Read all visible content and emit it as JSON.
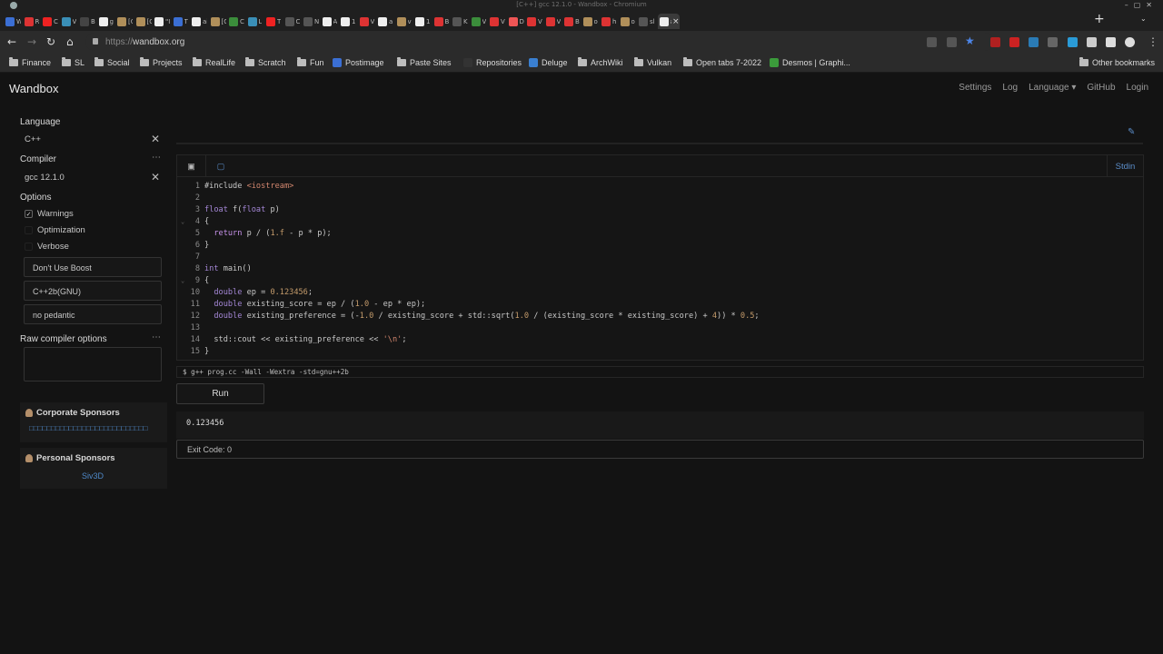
{
  "browser": {
    "window_title": "[C++] gcc 12.1.0 - Wandbox - Chromium",
    "url_scheme": "https://",
    "url_host": "wandbox.org",
    "tabs": [
      {
        "label": "W",
        "color": "#3b6fd4"
      },
      {
        "label": "R",
        "color": "#d33"
      },
      {
        "label": "C",
        "color": "#e22"
      },
      {
        "label": "V",
        "color": "#3a8fb7"
      },
      {
        "label": "B",
        "color": "#444"
      },
      {
        "label": "g",
        "color": "#eee"
      },
      {
        "label": "[C",
        "color": "#b08f5a"
      },
      {
        "label": "[C",
        "color": "#b08f5a"
      },
      {
        "label": "\"I",
        "color": "#eee"
      },
      {
        "label": "T",
        "color": "#3b6fd4"
      },
      {
        "label": "ai",
        "color": "#eee"
      },
      {
        "label": "[C",
        "color": "#b08f5a"
      },
      {
        "label": "C",
        "color": "#3b8d3b"
      },
      {
        "label": "L",
        "color": "#3a8fb7"
      },
      {
        "label": "T",
        "color": "#e22"
      },
      {
        "label": "C",
        "color": "#555"
      },
      {
        "label": "N",
        "color": "#555"
      },
      {
        "label": "A",
        "color": "#eee"
      },
      {
        "label": "1",
        "color": "#eee"
      },
      {
        "label": "V",
        "color": "#d33"
      },
      {
        "label": "a",
        "color": "#eee"
      },
      {
        "label": "v",
        "color": "#b08f5a"
      },
      {
        "label": "1",
        "color": "#eee"
      },
      {
        "label": "B",
        "color": "#d33"
      },
      {
        "label": "K",
        "color": "#555"
      },
      {
        "label": "V",
        "color": "#3b8d3b"
      },
      {
        "label": "V",
        "color": "#d33"
      },
      {
        "label": "D",
        "color": "#e55"
      },
      {
        "label": "V",
        "color": "#d33"
      },
      {
        "label": "V",
        "color": "#d33"
      },
      {
        "label": "B",
        "color": "#d33"
      },
      {
        "label": "o",
        "color": "#b08f5a"
      },
      {
        "label": "h",
        "color": "#d33"
      },
      {
        "label": "o",
        "color": "#b08f5a"
      },
      {
        "label": "sl",
        "color": "#555"
      },
      {
        "label": "a",
        "color": "#eee"
      }
    ],
    "bookmarks": [
      {
        "label": "Finance",
        "type": "folder"
      },
      {
        "label": "SL",
        "type": "folder"
      },
      {
        "label": "Social",
        "type": "folder"
      },
      {
        "label": "Projects",
        "type": "folder"
      },
      {
        "label": "RealLife",
        "type": "folder"
      },
      {
        "label": "Scratch",
        "type": "folder"
      },
      {
        "label": "Fun",
        "type": "folder"
      },
      {
        "label": "Postimage",
        "type": "site",
        "color": "#3b6fd4"
      },
      {
        "label": "Paste Sites",
        "type": "folder"
      },
      {
        "label": "Repositories",
        "type": "site",
        "color": "#333"
      },
      {
        "label": "Deluge",
        "type": "site",
        "color": "#3a7fd0"
      },
      {
        "label": "ArchWiki",
        "type": "folder"
      },
      {
        "label": "Vulkan",
        "type": "folder"
      },
      {
        "label": "Open tabs 7-2022",
        "type": "folder"
      },
      {
        "label": "Desmos | Graphi...",
        "type": "site",
        "color": "#3b9b3b"
      }
    ],
    "other_bookmarks": "Other bookmarks"
  },
  "app": {
    "brand": "Wandbox",
    "nav": [
      "Settings",
      "Log",
      "Language ▾",
      "GitHub",
      "Login"
    ]
  },
  "sidebar": {
    "language_label": "Language",
    "language_value": "C++",
    "compiler_label": "Compiler",
    "compiler_value": "gcc 12.1.0",
    "options_label": "Options",
    "options": [
      {
        "label": "Warnings",
        "checked": true
      },
      {
        "label": "Optimization",
        "checked": false
      },
      {
        "label": "Verbose",
        "checked": false
      }
    ],
    "selects": [
      "Don't Use Boost",
      "C++2b(GNU)",
      "no pedantic"
    ],
    "raw_label": "Raw compiler options",
    "corporate_title": "Corporate Sponsors",
    "corporate_link": "□□□□□□□□□□□□□□□□□□□□□□□□□□□",
    "personal_title": "Personal Sponsors",
    "personal_link": "Siv3D"
  },
  "editor": {
    "stdin_label": "Stdin",
    "lines": [
      "#include <iostream>",
      "",
      "float f(float p)",
      "{",
      "  return p / (1.f - p * p);",
      "}",
      "",
      "int main()",
      "{",
      "  double ep = 0.123456;",
      "  double existing_score = ep / (1.0 - ep * ep);",
      "  double existing_preference = (-1.0 / existing_score + std::sqrt(1.0 / (existing_score * existing_score) + 4)) * 0.5;",
      "",
      "  std::cout << existing_preference << '\\n';",
      "}"
    ]
  },
  "run": {
    "command": "$ g++ prog.cc -Wall -Wextra -std=gnu++2b",
    "button": "Run",
    "output": "0.123456",
    "exit_label": "Exit Code:",
    "exit_value": "0"
  }
}
